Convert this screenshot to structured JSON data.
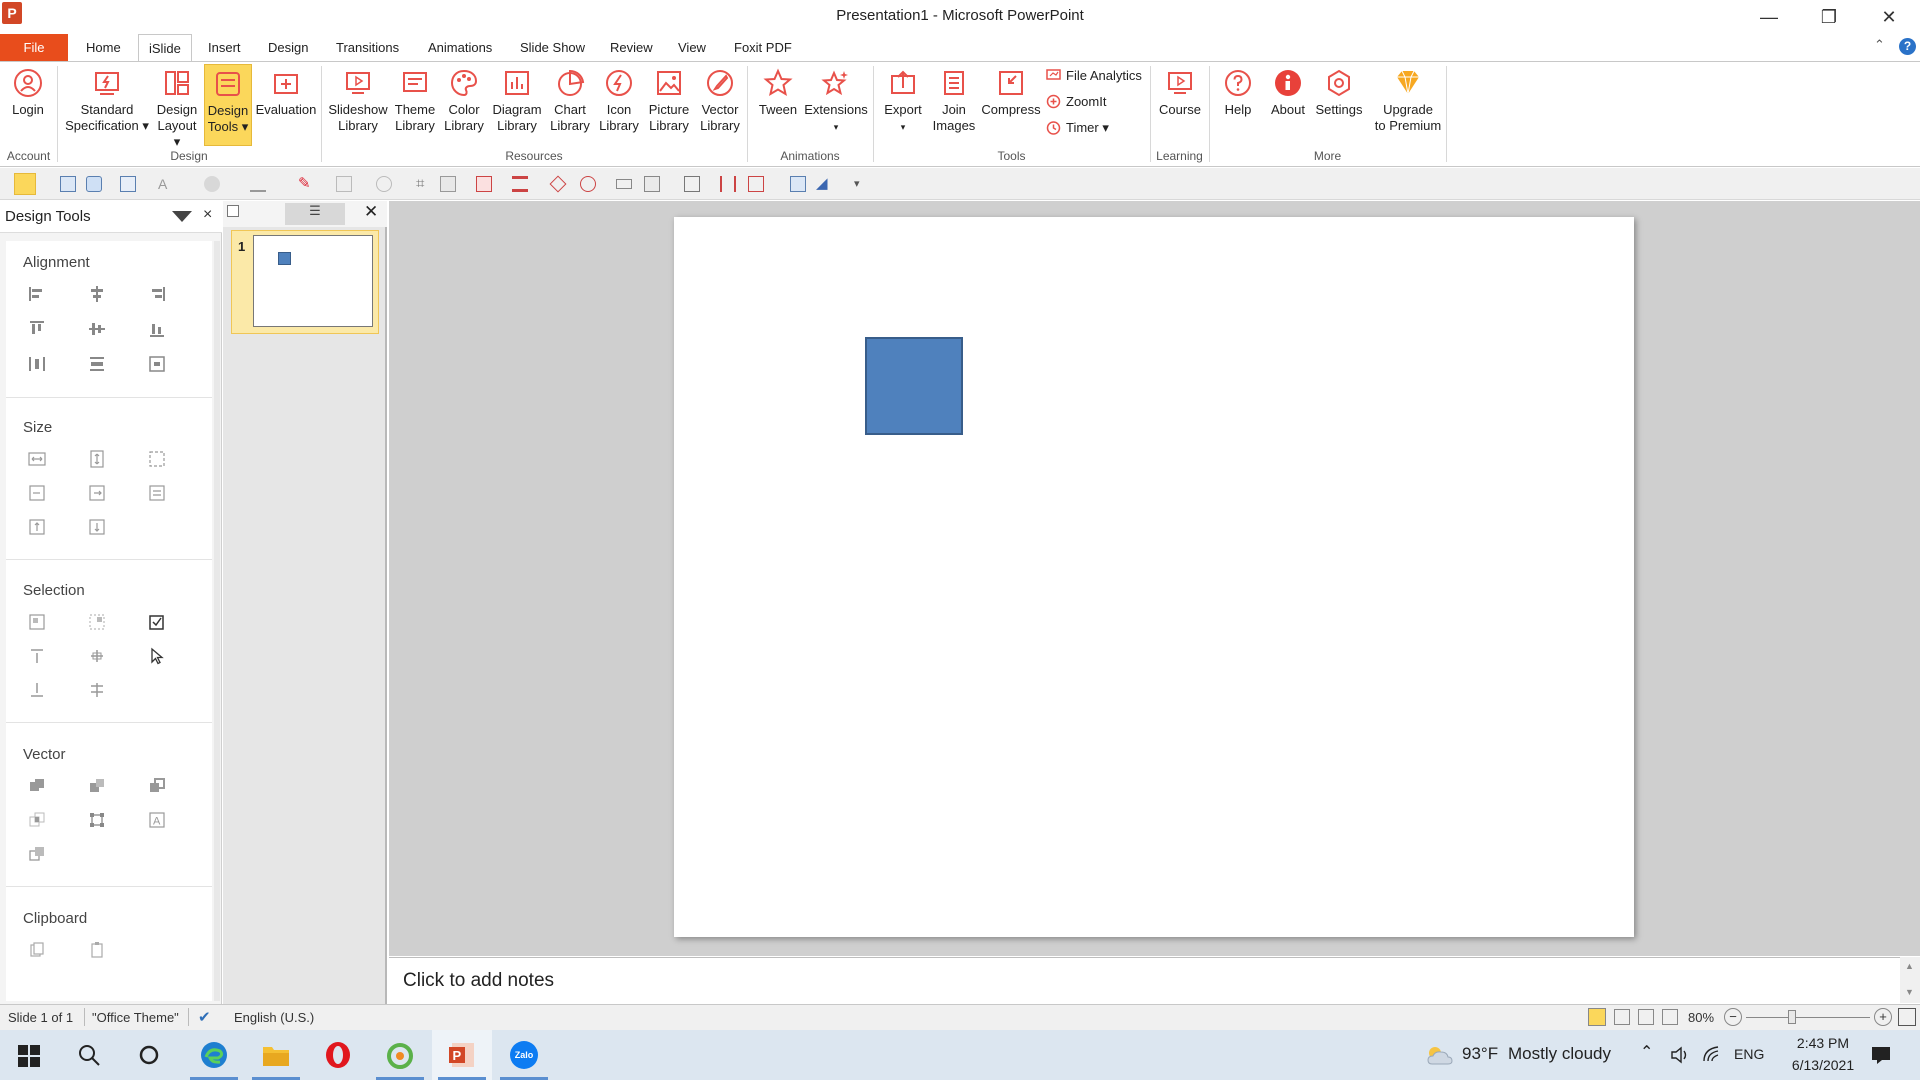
{
  "window": {
    "logo": "P",
    "title": "Presentation1 - Microsoft PowerPoint",
    "minimize": "—",
    "restore": "❐",
    "close": "✕"
  },
  "tabs": [
    "File",
    "Home",
    "iSlide",
    "Insert",
    "Design",
    "Transitions",
    "Animations",
    "Slide Show",
    "Review",
    "View",
    "Foxit PDF"
  ],
  "active_tab": "iSlide",
  "help_glyph": "?",
  "collapse_glyph": "⌃",
  "ribbon": {
    "login": "Login",
    "standard_1": "Standard",
    "standard_2": "Specification ▾",
    "design_layout_1": "Design",
    "design_layout_2": "Layout ▾",
    "design_tools_1": "Design",
    "design_tools_2": "Tools ▾",
    "evaluation": "Evaluation",
    "slideshow_1": "Slideshow",
    "slideshow_2": "Library",
    "theme_1": "Theme",
    "theme_2": "Library",
    "color_1": "Color",
    "color_2": "Library",
    "diagram_1": "Diagram",
    "diagram_2": "Library",
    "chart_1": "Chart",
    "chart_2": "Library",
    "icon_1": "Icon",
    "icon_2": "Library",
    "picture_1": "Picture",
    "picture_2": "Library",
    "vector_1": "Vector",
    "vector_2": "Library",
    "tween": "Tween",
    "extensions": "Extensions",
    "extensions_arrow": "▾",
    "export": "Export",
    "export_arrow": "▾",
    "join_1": "Join",
    "join_2": "Images",
    "compress": "Compress",
    "file_analytics": "File Analytics",
    "zoomit": "ZoomIt",
    "timer": "Timer ▾",
    "course": "Course",
    "help": "Help",
    "about": "About",
    "settings": "Settings",
    "upgrade_1": "Upgrade",
    "upgrade_2": "to Premium",
    "groups": {
      "account": "Account",
      "design": "Design",
      "resources": "Resources",
      "animations": "Animations",
      "tools": "Tools",
      "learning": "Learning",
      "more": "More"
    }
  },
  "design_tools_panel": {
    "title": "Design Tools",
    "close": "×",
    "sections": {
      "alignment": "Alignment",
      "size": "Size",
      "selection": "Selection",
      "vector": "Vector",
      "clipboard": "Clipboard"
    }
  },
  "thumbnails": {
    "close": "✕",
    "slide_number": "1"
  },
  "notes_placeholder": "Click to add notes",
  "statusbar": {
    "slide": "Slide 1 of 1",
    "theme": "\"Office Theme\"",
    "language": "English (U.S.)",
    "zoom": "80%",
    "zoom_out": "−",
    "zoom_in": "+"
  },
  "taskbar": {
    "weather_temp": "93°F",
    "weather_desc": "Mostly cloudy",
    "language": "ENG",
    "time": "2:43 PM",
    "date": "6/13/2021",
    "zalo": "Zalo"
  },
  "colors": {
    "accent_orange": "#e84d1c",
    "active_button": "#fbd75b",
    "shape_fill": "#4f81bd",
    "shape_border": "#385d8a"
  }
}
